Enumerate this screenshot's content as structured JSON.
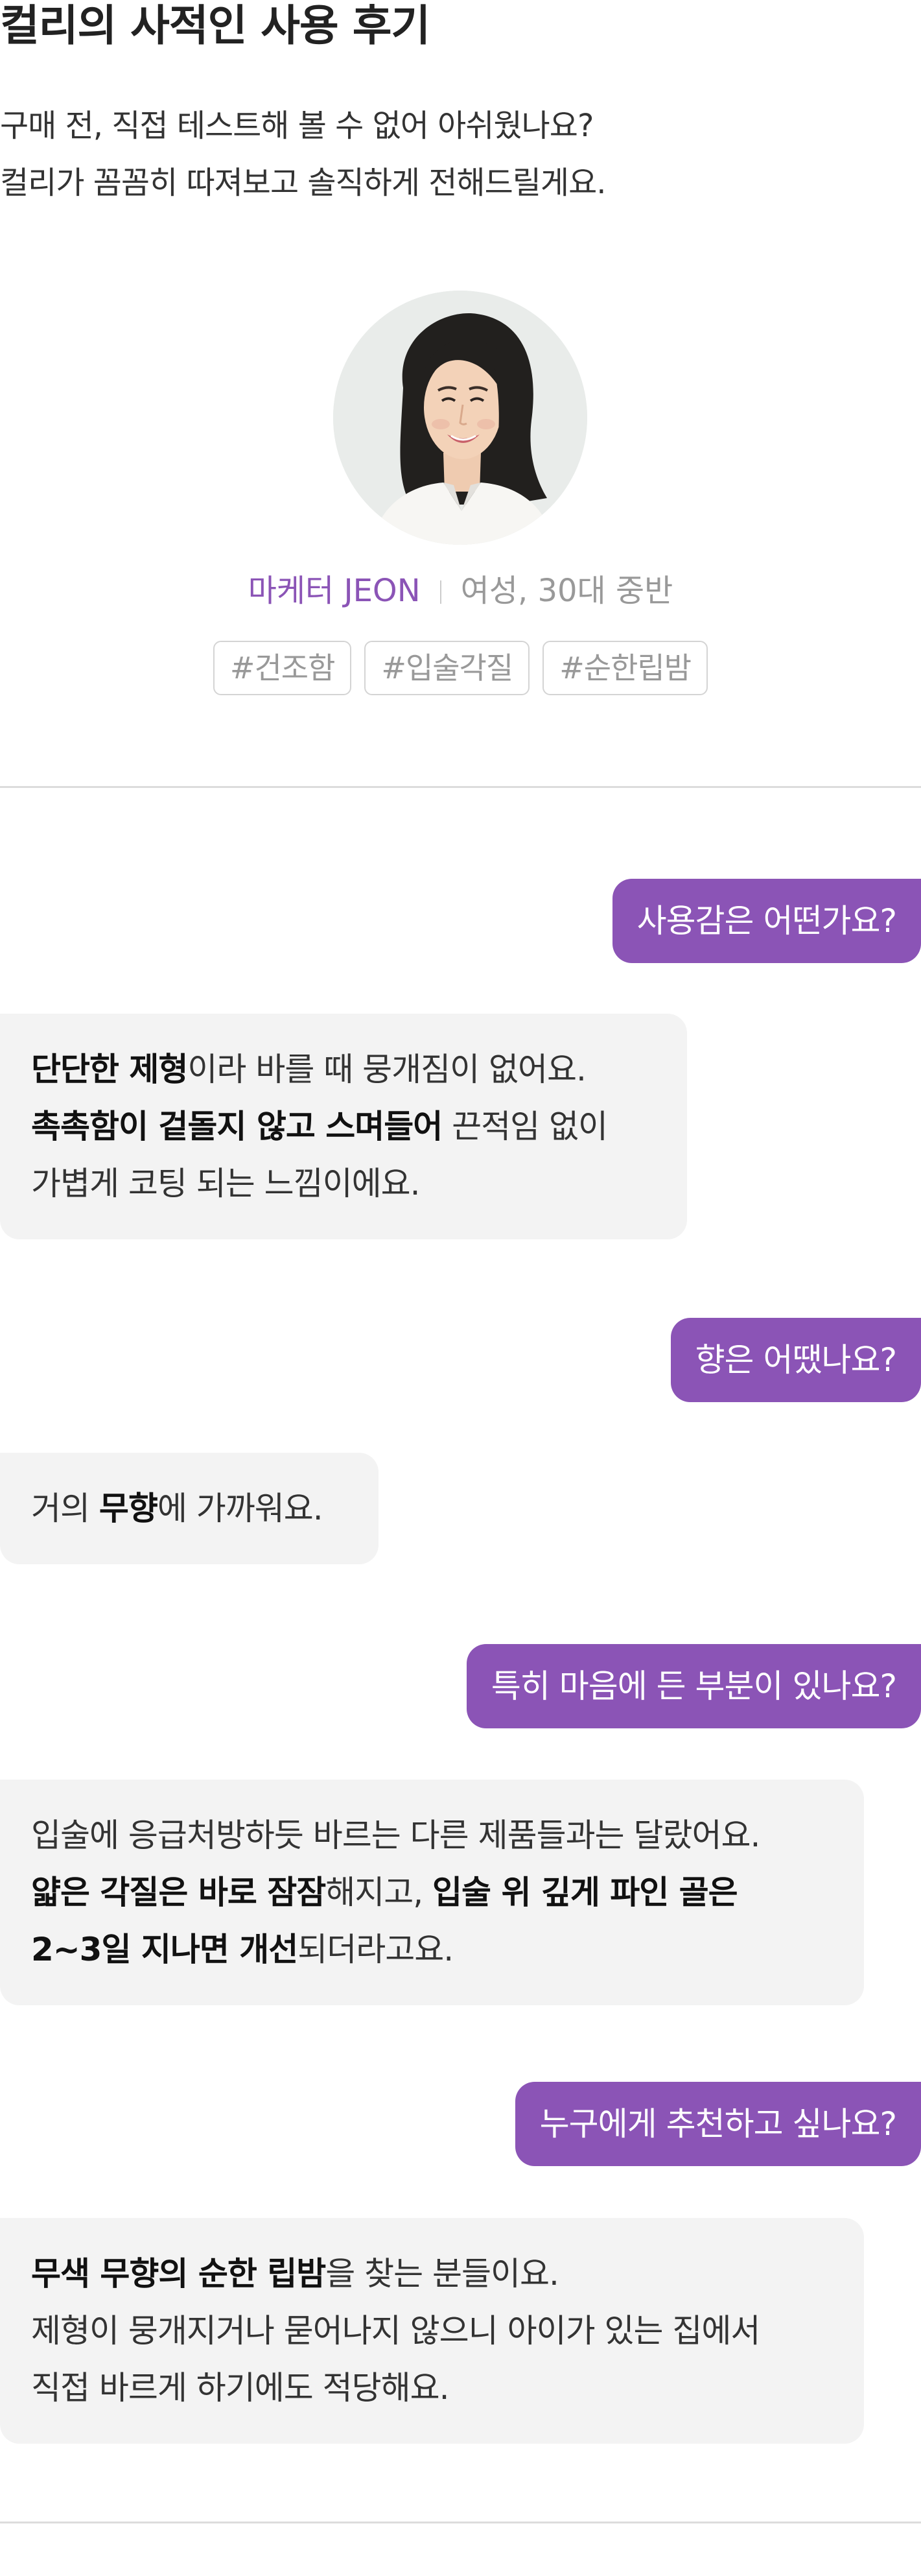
{
  "header": {
    "title": "컬리의 사적인 사용 후기",
    "subtitle_lines": [
      "구매 전, 직접 테스트해 볼 수 없어 아쉬웠나요?",
      "컬리가 꼼꼼히 따져보고 솔직하게 전해드릴게요."
    ]
  },
  "reviewer": {
    "name": "마케터 JEON",
    "info": "여성, 30대 중반",
    "tags": [
      "#건조함",
      "#입술각질",
      "#순한립밤"
    ]
  },
  "qa": [
    {
      "question": "사용감은 어떤가요?",
      "answer_lines": [
        [
          {
            "t": "단단한 제형",
            "b": true
          },
          {
            "t": "이라 바를 때 뭉개짐이 없어요.",
            "b": false
          }
        ],
        [
          {
            "t": "촉촉함이 겉돌지 않고 스며들어",
            "b": true
          },
          {
            "t": " 끈적임 없이",
            "b": false
          }
        ],
        [
          {
            "t": "가볍게 코팅 되는 느낌이에요.",
            "b": false
          }
        ]
      ]
    },
    {
      "question": "향은 어땠나요?",
      "answer_lines": [
        [
          {
            "t": "거의 ",
            "b": false
          },
          {
            "t": "무향",
            "b": true
          },
          {
            "t": "에 가까워요.",
            "b": false
          }
        ]
      ]
    },
    {
      "question": "특히 마음에 든 부분이 있나요?",
      "answer_lines": [
        [
          {
            "t": "입술에 응급처방하듯 바르는 다른 제품들과는 달랐어요.",
            "b": false
          }
        ],
        [
          {
            "t": "얇은 각질은 바로 잠잠",
            "b": true
          },
          {
            "t": "해지고, ",
            "b": false
          },
          {
            "t": "입술 위 깊게 파인 골은",
            "b": true
          }
        ],
        [
          {
            "t": "2~3일 지나면 개선",
            "b": true
          },
          {
            "t": "되더라고요.",
            "b": false
          }
        ]
      ]
    },
    {
      "question": "누구에게 추천하고 싶나요?",
      "answer_lines": [
        [
          {
            "t": "무색 무향의 순한 립밤",
            "b": true
          },
          {
            "t": "을 찾는 분들이요.",
            "b": false
          }
        ],
        [
          {
            "t": "제형이 뭉개지거나 묻어나지 않으니 아이가 있는 집에서",
            "b": false
          }
        ],
        [
          {
            "t": "직접 바르게 하기에도 적당해요.",
            "b": false
          }
        ]
      ]
    }
  ],
  "colors": {
    "accent": "#8b54b6",
    "answer_bg": "#f3f3f3",
    "divider": "#dcdcdc",
    "muted_text": "#999999"
  }
}
